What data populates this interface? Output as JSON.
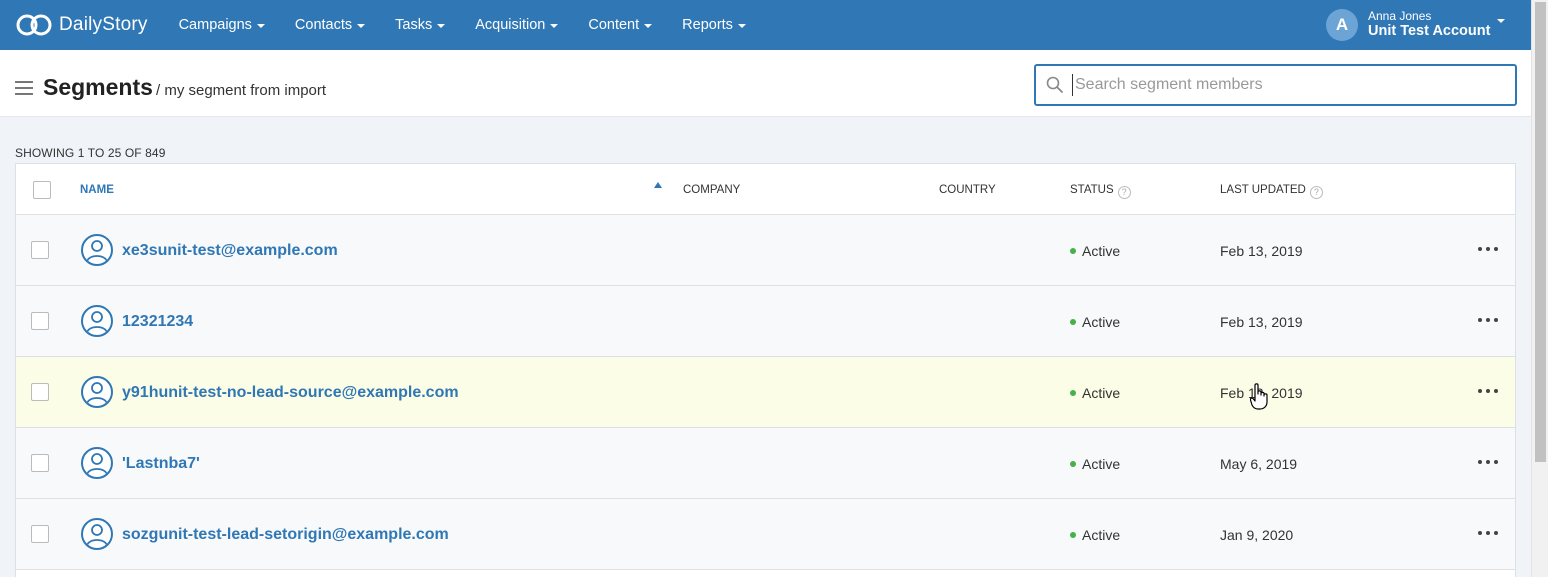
{
  "app": {
    "brand": "DailyStory",
    "nav": [
      "Campaigns",
      "Contacts",
      "Tasks",
      "Acquisition",
      "Content",
      "Reports"
    ],
    "user": {
      "initial": "A",
      "name": "Anna Jones",
      "account": "Unit Test Account"
    }
  },
  "header": {
    "title": "Segments",
    "subtitle": "/ my segment from import",
    "search_placeholder": "Search segment members"
  },
  "table": {
    "showing": "SHOWING 1 TO 25 OF 849",
    "columns": {
      "name": "NAME",
      "company": "COMPANY",
      "country": "COUNTRY",
      "status": "STATUS",
      "last_updated": "LAST UPDATED"
    },
    "rows": [
      {
        "name": "xe3sunit-test@example.com",
        "company": "",
        "country": "",
        "status": "Active",
        "last_updated": "Feb 13, 2019"
      },
      {
        "name": "12321234",
        "company": "",
        "country": "",
        "status": "Active",
        "last_updated": "Feb 13, 2019"
      },
      {
        "name": "y91hunit-test-no-lead-source@example.com",
        "company": "",
        "country": "",
        "status": "Active",
        "last_updated": "Feb 13, 2019"
      },
      {
        "name": "'Lastnba7'",
        "company": "",
        "country": "",
        "status": "Active",
        "last_updated": "May 6, 2019"
      },
      {
        "name": "sozgunit-test-lead-setorigin@example.com",
        "company": "",
        "country": "",
        "status": "Active",
        "last_updated": "Jan 9, 2020"
      }
    ]
  },
  "icons": {
    "logo": "infinity-logo-icon",
    "search": "search-icon",
    "menu": "hamburger-menu-icon",
    "row_avatar": "user-avatar-icon",
    "row_more": "more-horizontal-icon",
    "help": "question-circle-icon"
  },
  "colors": {
    "brand": "#2f77b5",
    "status_active": "#46b04a",
    "highlight_row": "#fcfde6"
  }
}
